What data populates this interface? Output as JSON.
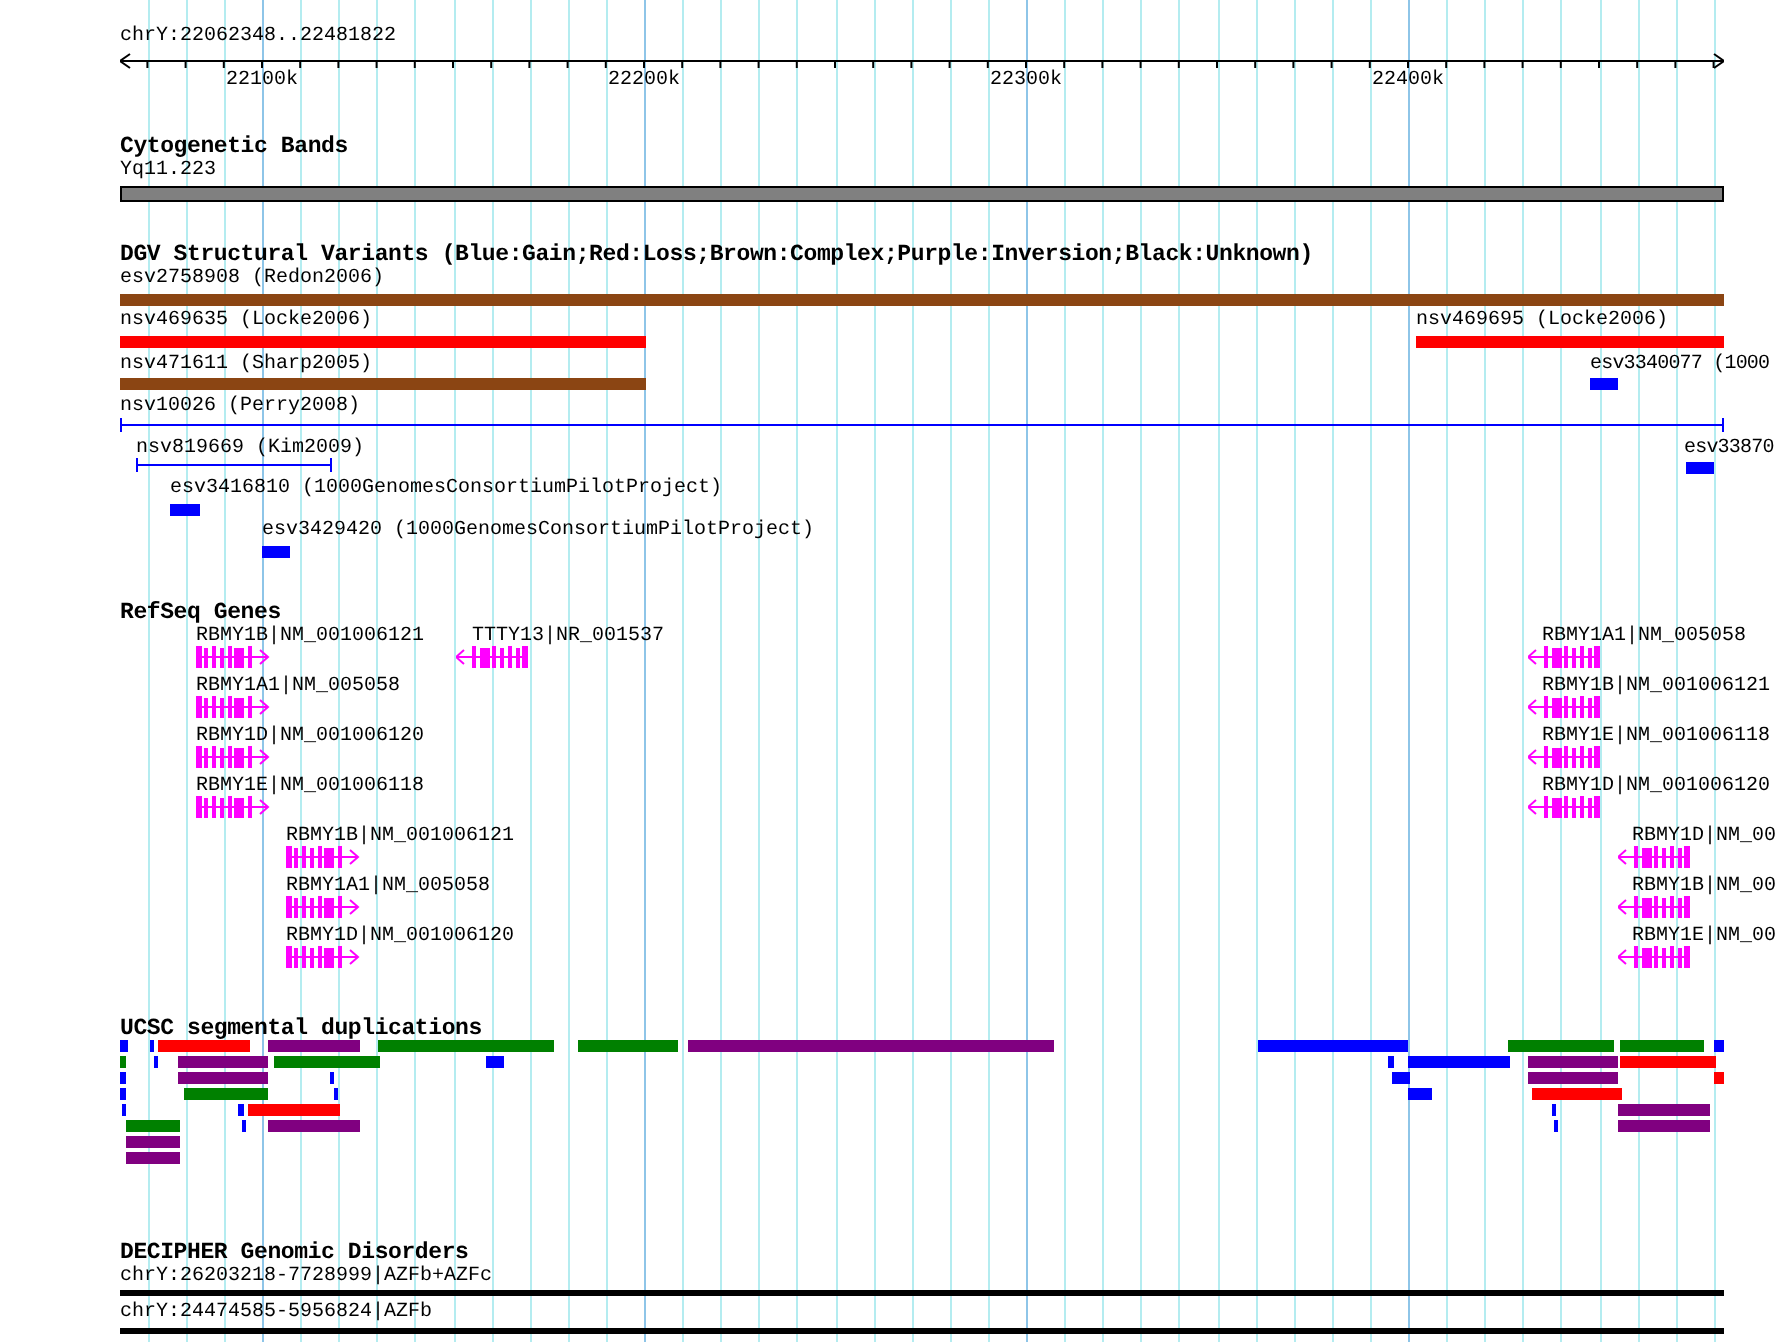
{
  "ruler": {
    "range": "chrY:22062348..22481822",
    "ticks": [
      "22100k",
      "22200k",
      "22300k",
      "22400k"
    ]
  },
  "tracks": [
    {
      "kind": "cytoband",
      "title": "Cytogenetic Bands",
      "features": [
        {
          "label": "Yq11.223"
        }
      ]
    },
    {
      "kind": "dgv",
      "title": "DGV Structural Variants (Blue:Gain;Red:Loss;Brown:Complex;Purple:Inversion;Black:Unknown)",
      "features": [
        {
          "label": "esv2758908 (Redon2006)",
          "kind": "bar",
          "color": "#8b4513"
        },
        {
          "label": "nsv469635 (Locke2006)",
          "kind": "bar",
          "color": "#ff0000"
        },
        {
          "label": "nsv469695 (Locke2006)",
          "kind": "bar",
          "color": "#ff0000"
        },
        {
          "label": "nsv471611 (Sharp2005)",
          "kind": "bar",
          "color": "#8b4513"
        },
        {
          "label": "esv3340077 (1000",
          "kind": "bar",
          "color": "#0000ff"
        },
        {
          "label": "nsv10026 (Perry2008)",
          "kind": "span",
          "color": "#0000ff"
        },
        {
          "label": "nsv819669 (Kim2009)",
          "kind": "span",
          "color": "#0000ff"
        },
        {
          "label": "esv33870",
          "kind": "bar",
          "color": "#0000ff"
        },
        {
          "label": "esv3416810 (1000GenomesConsortiumPilotProject)",
          "kind": "bar",
          "color": "#0000ff"
        },
        {
          "label": "esv3429420 (1000GenomesConsortiumPilotProject)",
          "kind": "bar",
          "color": "#0000ff"
        }
      ]
    },
    {
      "kind": "genes",
      "title": "RefSeq Genes",
      "features": [
        {
          "label": "RBMY1B|NM_001006121",
          "reverse": false
        },
        {
          "label": "TTTY13|NR_001537",
          "reverse": true
        },
        {
          "label": "RBMY1A1|NM_005058",
          "reverse": false
        },
        {
          "label": "RBMY1D|NM_001006120",
          "reverse": false
        },
        {
          "label": "RBMY1E|NM_001006118",
          "reverse": false
        },
        {
          "label": "RBMY1B|NM_001006121",
          "reverse": false
        },
        {
          "label": "RBMY1A1|NM_005058",
          "reverse": false
        },
        {
          "label": "RBMY1D|NM_001006120",
          "reverse": false
        },
        {
          "label": "RBMY1A1|NM_005058",
          "reverse": true
        },
        {
          "label": "RBMY1B|NM_001006121",
          "reverse": true
        },
        {
          "label": "RBMY1E|NM_001006118",
          "reverse": true
        },
        {
          "label": "RBMY1D|NM_001006120",
          "reverse": true
        },
        {
          "label": "RBMY1D|NM_00",
          "reverse": true
        },
        {
          "label": "RBMY1B|NM_00",
          "reverse": true
        },
        {
          "label": "RBMY1E|NM_00",
          "reverse": true
        }
      ]
    },
    {
      "kind": "segdup",
      "title": "UCSC segmental duplications",
      "features": [
        {
          "color": "#0000ff"
        },
        {
          "color": "#0000ff"
        },
        {
          "color": "#ff0000"
        },
        {
          "color": "#800080"
        },
        {
          "color": "#008000"
        },
        {
          "color": "#008000"
        },
        {
          "color": "#800080"
        },
        {
          "color": "#0000ff"
        },
        {
          "color": "#008000"
        },
        {
          "color": "#008000"
        },
        {
          "color": "#0000ff"
        },
        {
          "color": "#008000"
        },
        {
          "color": "#0000ff"
        },
        {
          "color": "#800080"
        },
        {
          "color": "#008000"
        },
        {
          "color": "#0000ff"
        },
        {
          "color": "#0000ff"
        },
        {
          "color": "#0000ff"
        },
        {
          "color": "#800080"
        },
        {
          "color": "#ff0000"
        },
        {
          "color": "#0000ff"
        },
        {
          "color": "#800080"
        },
        {
          "color": "#0000ff"
        },
        {
          "color": "#0000ff"
        },
        {
          "color": "#800080"
        },
        {
          "color": "#ff0000"
        },
        {
          "color": "#0000ff"
        },
        {
          "color": "#008000"
        },
        {
          "color": "#0000ff"
        },
        {
          "color": "#0000ff"
        },
        {
          "color": "#ff0000"
        },
        {
          "color": "#0000ff"
        },
        {
          "color": "#0000ff"
        },
        {
          "color": "#ff0000"
        },
        {
          "color": "#0000ff"
        },
        {
          "color": "#800080"
        },
        {
          "color": "#008000"
        },
        {
          "color": "#0000ff"
        },
        {
          "color": "#800080"
        },
        {
          "color": "#0000ff"
        },
        {
          "color": "#800080"
        },
        {
          "color": "#800080"
        },
        {
          "color": "#800080"
        }
      ]
    },
    {
      "kind": "decipher",
      "title": "DECIPHER Genomic Disorders",
      "features": [
        {
          "label": "chrY:26203218-7728999|AZFb+AZFc"
        },
        {
          "label": "chrY:24474585-5956824|AZFb"
        }
      ]
    }
  ]
}
